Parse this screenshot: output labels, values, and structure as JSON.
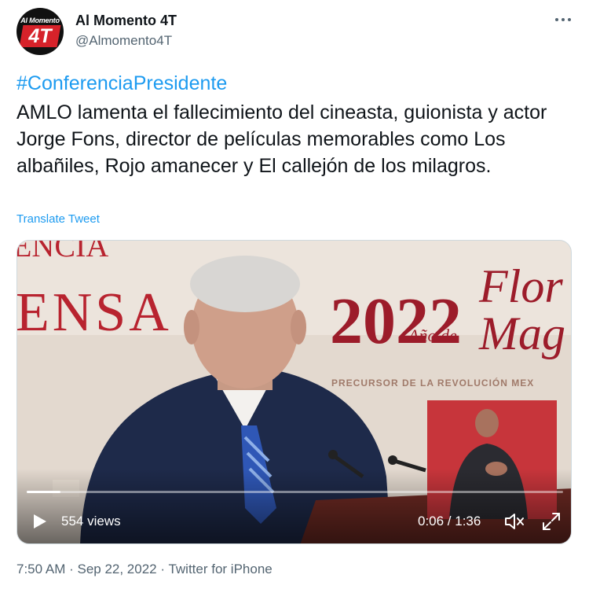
{
  "author": {
    "display_name": "Al Momento 4T",
    "handle": "@Almomento4T",
    "avatar_text_top": "Al Momento",
    "avatar_text_main": "4T"
  },
  "tweet": {
    "hashtag": "#ConferenciaPresidente",
    "text": "AMLO lamenta el fallecimiento del cineasta, guionista y actor Jorge Fons, director de películas memorables como Los albañiles, Rojo amanecer y El callejón de los milagros.",
    "translate_label": "Translate Tweet"
  },
  "video": {
    "views_label": "554 views",
    "time_label": "0:06 / 1:36",
    "progress": 0.0625,
    "backdrop_year": "2022",
    "backdrop_text_left": "ENSA",
    "backdrop_subtitle": "Año de",
    "backdrop_word_1": "Flor",
    "backdrop_word_2": "Mag",
    "backdrop_footer": "PRECURSOR DE LA REVOLUCIÓN MEX"
  },
  "meta": {
    "time": "7:50 AM",
    "date": "Sep 22, 2022",
    "source": "Twitter for iPhone",
    "separator": " · "
  },
  "icons": {
    "more": "more-dots-icon",
    "play": "play-icon",
    "mute": "volume-muted-icon",
    "fullscreen": "fullscreen-icon"
  },
  "colors": {
    "accent": "#1d9bf0",
    "text": "#0f1419",
    "secondary": "#536471"
  }
}
